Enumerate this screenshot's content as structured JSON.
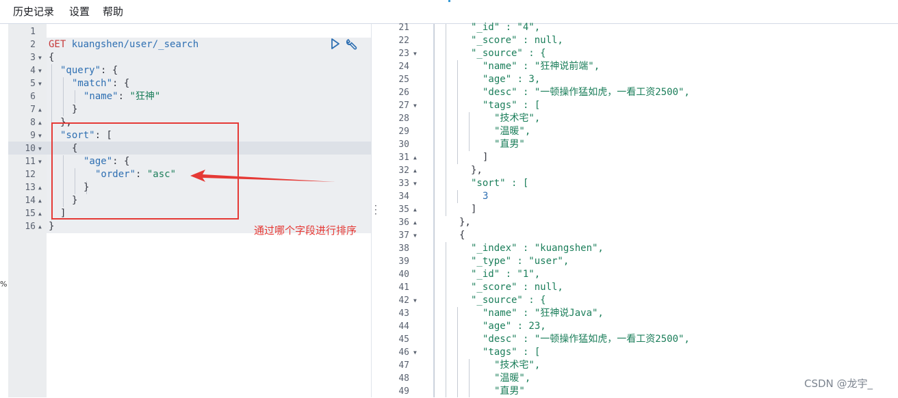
{
  "menu": {
    "history": "历史记录",
    "settings": "设置",
    "help": "帮助"
  },
  "sidebar": {
    "close_glyph": "×",
    "percent_glyph": "%"
  },
  "request": {
    "line_numbers": [
      "1",
      "2",
      "3",
      "4",
      "5",
      "6",
      "7",
      "8",
      "9",
      "10",
      "11",
      "12",
      "13",
      "14",
      "15",
      "16"
    ],
    "method": "GET",
    "url": "kuangshen/user/_search",
    "lines": {
      "l3": "{",
      "l4_key": "\"query\"",
      "l4_rest": ": {",
      "l5_key": "\"match\"",
      "l5_rest": ": {",
      "l6_key": "\"name\"",
      "l6_sep": ": ",
      "l6_val": "\"狂神\"",
      "l7": "}",
      "l8": "},",
      "l9_key": "\"sort\"",
      "l9_rest": ": [",
      "l10": "{",
      "l11_key": "\"age\"",
      "l11_rest": ": {",
      "l12_key": "\"order\"",
      "l12_sep": ": ",
      "l12_val": "\"asc\"",
      "l13": "}",
      "l14": "}",
      "l15": "]",
      "l16": "}"
    }
  },
  "annotation": {
    "text": "通过哪个字段进行排序",
    "color": "#e53935"
  },
  "response": {
    "line_numbers": [
      "21",
      "22",
      "23",
      "24",
      "25",
      "26",
      "27",
      "28",
      "29",
      "30",
      "31",
      "32",
      "33",
      "34",
      "35",
      "36",
      "37",
      "38",
      "39",
      "40",
      "41",
      "42",
      "43",
      "44",
      "45",
      "46",
      "47",
      "48",
      "49"
    ],
    "lines": {
      "r21": "\"_id\" : \"4\",",
      "r22": "\"_score\" : null,",
      "r23": "\"_source\" : {",
      "r24": "\"name\" : \"狂神说前端\",",
      "r25": "\"age\" : 3,",
      "r26": "\"desc\" : \"一顿操作猛如虎，一看工资2500\",",
      "r27": "\"tags\" : [",
      "r28": "\"技术宅\",",
      "r29": "\"温暖\",",
      "r30": "\"直男\"",
      "r31": "]",
      "r32": "},",
      "r33": "\"sort\" : [",
      "r34": "3",
      "r35": "]",
      "r36": "},",
      "r37": "{",
      "r38": "\"_index\" : \"kuangshen\",",
      "r39": "\"_type\" : \"user\",",
      "r40": "\"_id\" : \"1\",",
      "r41": "\"_score\" : null,",
      "r42": "\"_source\" : {",
      "r43": "\"name\" : \"狂神说Java\",",
      "r44": "\"age\" : 23,",
      "r45": "\"desc\" : \"一顿操作猛如虎，一看工资2500\",",
      "r46": "\"tags\" : [",
      "r47": "\"技术宅\",",
      "r48": "\"温暖\",",
      "r49": "\"直男\""
    }
  },
  "watermark": "CSDN @龙宇_"
}
